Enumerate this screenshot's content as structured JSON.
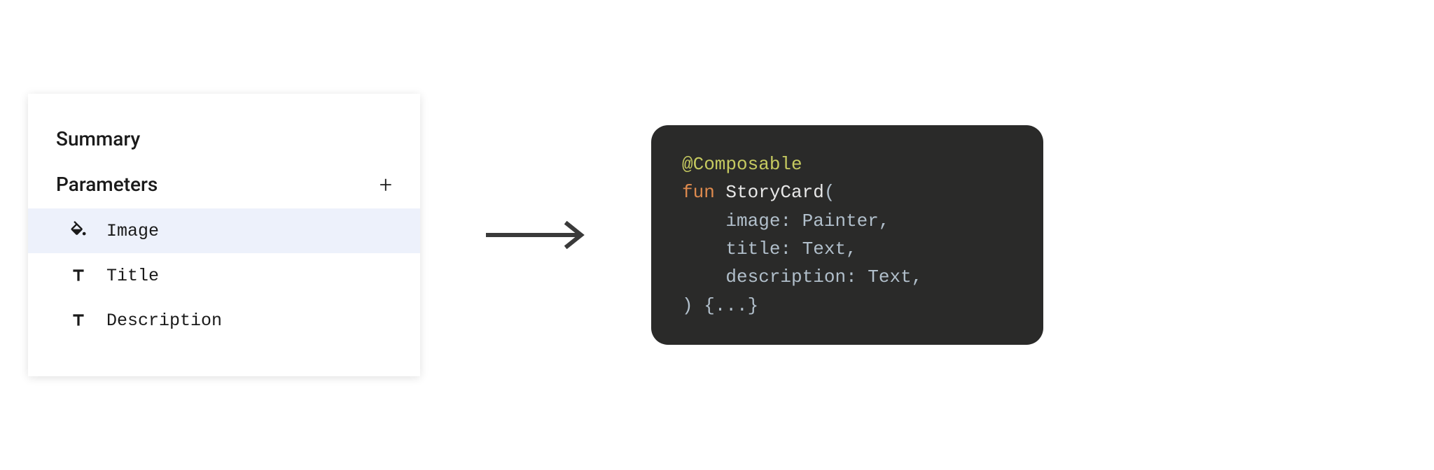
{
  "panel": {
    "summary_title": "Summary",
    "parameters_title": "Parameters",
    "items": [
      {
        "label": "Image",
        "icon": "paint-fill",
        "selected": true
      },
      {
        "label": "Title",
        "icon": "text",
        "selected": false
      },
      {
        "label": "Description",
        "icon": "text",
        "selected": false
      }
    ]
  },
  "code": {
    "annotation": "@Composable",
    "keyword": "fun",
    "fn_name": "StoryCard",
    "open_paren": "(",
    "params": [
      {
        "name": "image",
        "type": "Painter"
      },
      {
        "name": "title",
        "type": "Text"
      },
      {
        "name": "description",
        "type": "Text"
      }
    ],
    "close": ") {...}",
    "indent": "    "
  }
}
